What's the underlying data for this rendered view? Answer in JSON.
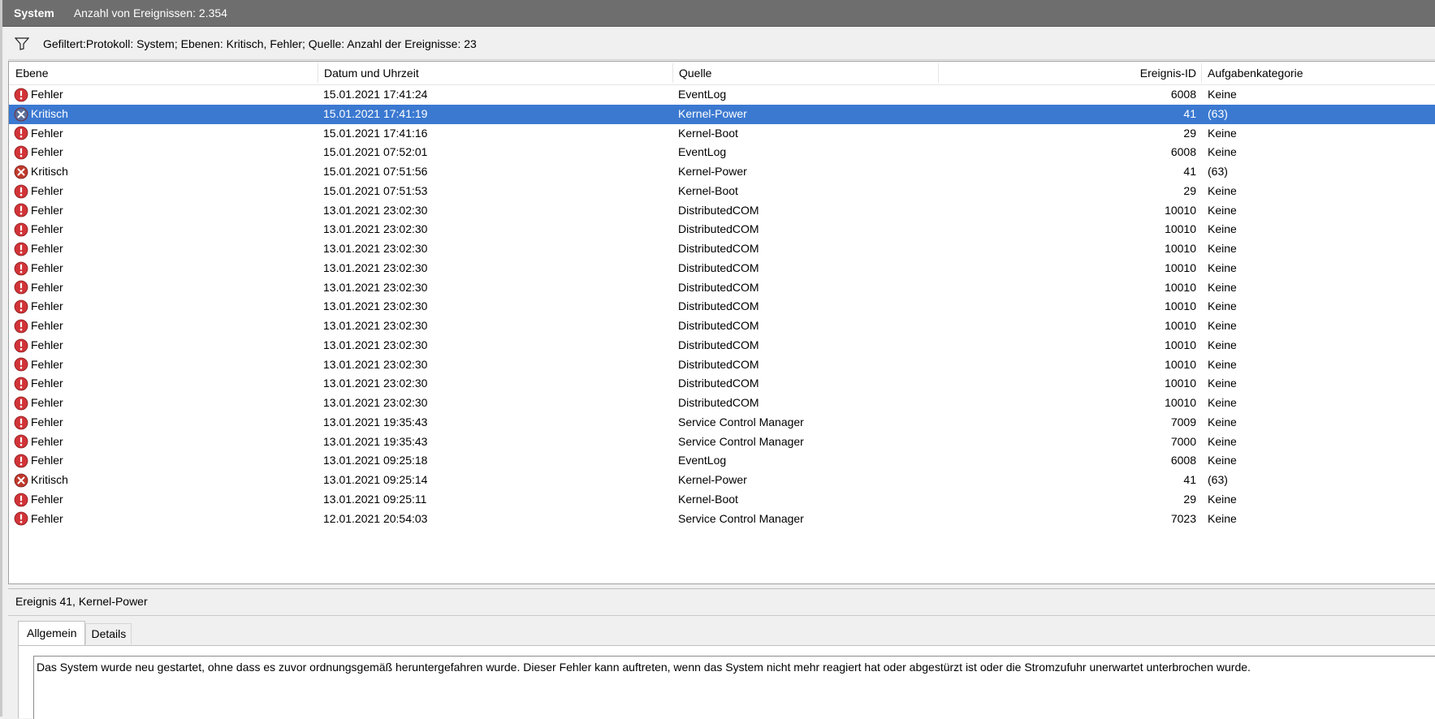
{
  "window": {
    "title": "System",
    "event_count": "Anzahl von Ereignissen: 2.354"
  },
  "filter": {
    "icon": "filter-icon",
    "text": "Gefiltert:Protokoll: System; Ebenen: Kritisch, Fehler; Quelle:  Anzahl der Ereignisse: 23"
  },
  "columns": {
    "level": "Ebene",
    "date": "Datum und Uhrzeit",
    "source": "Quelle",
    "event_id": "Ereignis-ID",
    "category": "Aufgabenkategorie"
  },
  "colors": {
    "error_icon": "#d13438",
    "critical_icon": "#c0392b",
    "selection": "#3b79d1",
    "titlebar": "#6e6e6e"
  },
  "events": [
    {
      "level": "Fehler",
      "date": "15.01.2021 17:41:24",
      "source": "EventLog",
      "id": "6008",
      "category": "Keine",
      "icon": "error-icon"
    },
    {
      "level": "Kritisch",
      "date": "15.01.2021 17:41:19",
      "source": "Kernel-Power",
      "id": "41",
      "category": "(63)",
      "icon": "critical-icon",
      "selected": true
    },
    {
      "level": "Fehler",
      "date": "15.01.2021 17:41:16",
      "source": "Kernel-Boot",
      "id": "29",
      "category": "Keine",
      "icon": "error-icon"
    },
    {
      "level": "Fehler",
      "date": "15.01.2021 07:52:01",
      "source": "EventLog",
      "id": "6008",
      "category": "Keine",
      "icon": "error-icon"
    },
    {
      "level": "Kritisch",
      "date": "15.01.2021 07:51:56",
      "source": "Kernel-Power",
      "id": "41",
      "category": "(63)",
      "icon": "critical-icon"
    },
    {
      "level": "Fehler",
      "date": "15.01.2021 07:51:53",
      "source": "Kernel-Boot",
      "id": "29",
      "category": "Keine",
      "icon": "error-icon"
    },
    {
      "level": "Fehler",
      "date": "13.01.2021 23:02:30",
      "source": "DistributedCOM",
      "id": "10010",
      "category": "Keine",
      "icon": "error-icon"
    },
    {
      "level": "Fehler",
      "date": "13.01.2021 23:02:30",
      "source": "DistributedCOM",
      "id": "10010",
      "category": "Keine",
      "icon": "error-icon"
    },
    {
      "level": "Fehler",
      "date": "13.01.2021 23:02:30",
      "source": "DistributedCOM",
      "id": "10010",
      "category": "Keine",
      "icon": "error-icon"
    },
    {
      "level": "Fehler",
      "date": "13.01.2021 23:02:30",
      "source": "DistributedCOM",
      "id": "10010",
      "category": "Keine",
      "icon": "error-icon"
    },
    {
      "level": "Fehler",
      "date": "13.01.2021 23:02:30",
      "source": "DistributedCOM",
      "id": "10010",
      "category": "Keine",
      "icon": "error-icon"
    },
    {
      "level": "Fehler",
      "date": "13.01.2021 23:02:30",
      "source": "DistributedCOM",
      "id": "10010",
      "category": "Keine",
      "icon": "error-icon"
    },
    {
      "level": "Fehler",
      "date": "13.01.2021 23:02:30",
      "source": "DistributedCOM",
      "id": "10010",
      "category": "Keine",
      "icon": "error-icon"
    },
    {
      "level": "Fehler",
      "date": "13.01.2021 23:02:30",
      "source": "DistributedCOM",
      "id": "10010",
      "category": "Keine",
      "icon": "error-icon"
    },
    {
      "level": "Fehler",
      "date": "13.01.2021 23:02:30",
      "source": "DistributedCOM",
      "id": "10010",
      "category": "Keine",
      "icon": "error-icon"
    },
    {
      "level": "Fehler",
      "date": "13.01.2021 23:02:30",
      "source": "DistributedCOM",
      "id": "10010",
      "category": "Keine",
      "icon": "error-icon"
    },
    {
      "level": "Fehler",
      "date": "13.01.2021 23:02:30",
      "source": "DistributedCOM",
      "id": "10010",
      "category": "Keine",
      "icon": "error-icon"
    },
    {
      "level": "Fehler",
      "date": "13.01.2021 19:35:43",
      "source": "Service Control Manager",
      "id": "7009",
      "category": "Keine",
      "icon": "error-icon"
    },
    {
      "level": "Fehler",
      "date": "13.01.2021 19:35:43",
      "source": "Service Control Manager",
      "id": "7000",
      "category": "Keine",
      "icon": "error-icon"
    },
    {
      "level": "Fehler",
      "date": "13.01.2021 09:25:18",
      "source": "EventLog",
      "id": "6008",
      "category": "Keine",
      "icon": "error-icon"
    },
    {
      "level": "Kritisch",
      "date": "13.01.2021 09:25:14",
      "source": "Kernel-Power",
      "id": "41",
      "category": "(63)",
      "icon": "critical-icon"
    },
    {
      "level": "Fehler",
      "date": "13.01.2021 09:25:11",
      "source": "Kernel-Boot",
      "id": "29",
      "category": "Keine",
      "icon": "error-icon"
    },
    {
      "level": "Fehler",
      "date": "12.01.2021 20:54:03",
      "source": "Service Control Manager",
      "id": "7023",
      "category": "Keine",
      "icon": "error-icon"
    }
  ],
  "detail": {
    "title": "Ereignis 41, Kernel-Power",
    "tabs": [
      "Allgemein",
      "Details"
    ],
    "description": "Das System wurde neu gestartet, ohne dass es zuvor ordnungsgemäß heruntergefahren wurde. Dieser Fehler kann auftreten, wenn das System nicht mehr reagiert hat oder abgestürzt ist oder die Stromzufuhr unerwartet unterbrochen wurde."
  }
}
